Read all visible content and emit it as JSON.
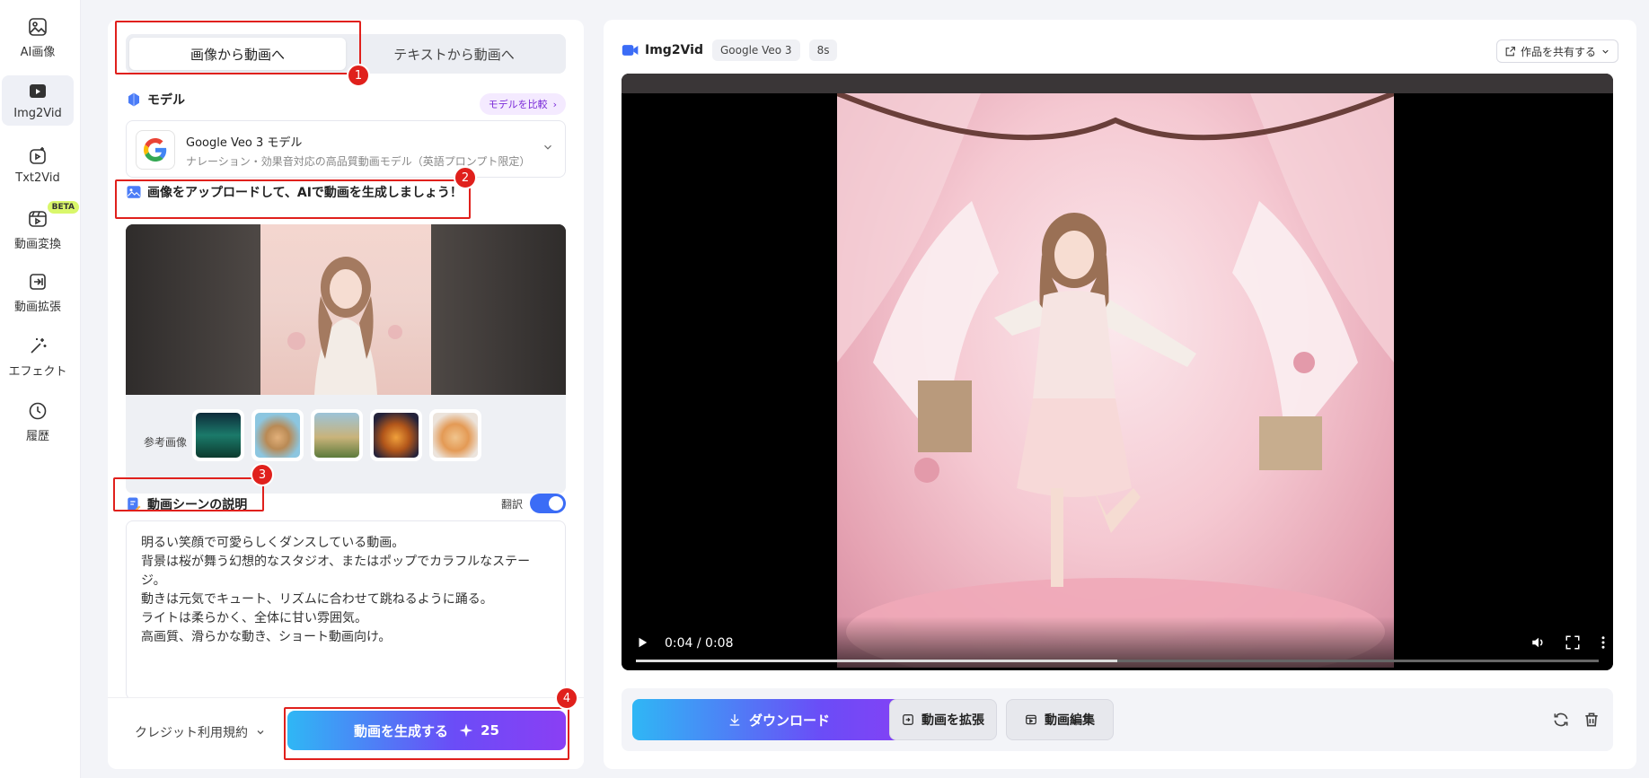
{
  "nav": {
    "items": [
      {
        "label": "AI画像",
        "icon": "image-icon"
      },
      {
        "label": "Img2Vid",
        "icon": "img2vid-icon"
      },
      {
        "label": "Txt2Vid",
        "icon": "txt2vid-icon"
      },
      {
        "label": "動画変換",
        "icon": "video-convert-icon",
        "badge": "BETA"
      },
      {
        "label": "動画拡張",
        "icon": "video-extend-icon"
      },
      {
        "label": "エフェクト",
        "icon": "magic-wand-icon"
      },
      {
        "label": "履歴",
        "icon": "history-icon"
      }
    ],
    "active_index": 1
  },
  "tabs": [
    "画像から動画へ",
    "テキストから動画へ"
  ],
  "model": {
    "section_title": "モデル",
    "compare_label": "モデルを比較",
    "name": "Google Veo 3 モデル",
    "description": "ナレーション・効果音対応の高品質動画モデル（英語プロンプト限定）"
  },
  "upload": {
    "title": "画像をアップロードして、AIで動画を生成しましょう！",
    "ref_label": "参考画像",
    "thumbnails": [
      "aurora-thumbnail",
      "hamster-thumbnail",
      "rider-thumbnail",
      "perfume-thumbnail",
      "cat-thumbnail"
    ]
  },
  "description": {
    "title": "動画シーンの説明",
    "translate_label": "翻訳",
    "translate_on": true,
    "lines": [
      "明るい笑顔で可愛らしくダンスしている動画。",
      "背景は桜が舞う幻想的なスタジオ、またはポップでカラフルなステー",
      "ジ。",
      "動きは元気でキュート、リズムに合わせて跳ねるように踊る。",
      "ライトは柔らかく、全体に甘い雰囲気。",
      "高画質、滑らかな動き、ショート動画向け。"
    ]
  },
  "footer": {
    "terms_label": "クレジット利用規約",
    "generate_label": "動画を生成する",
    "credits": "25"
  },
  "result": {
    "app_name": "Img2Vid",
    "model_chip": "Google Veo 3",
    "duration_chip": "8s",
    "share_label": "作品を共有する",
    "video_time": "0:04 / 0:08",
    "progress": 0.5,
    "download_label": "ダウンロード",
    "extend_label": "動画を拡張",
    "edit_label": "動画編集"
  },
  "annotations": [
    "1",
    "2",
    "3",
    "4"
  ],
  "colors": {
    "accent": "#3b6cf6",
    "annotation": "#e0201c",
    "gradient_start": "#2fb7f5",
    "gradient_end": "#8a3ff4"
  }
}
